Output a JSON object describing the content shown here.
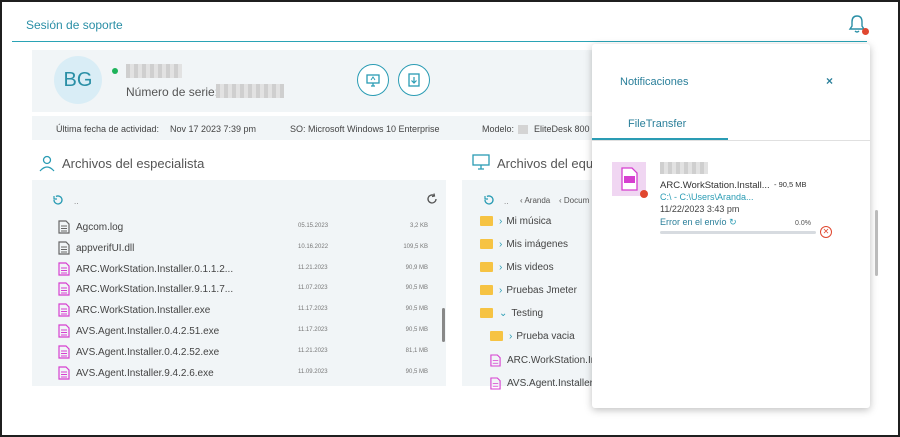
{
  "header": {
    "title": "Sesión de soporte"
  },
  "user": {
    "initials": "BG",
    "serial_label": "Número de serie:"
  },
  "activity": {
    "last_label": "Última fecha de actividad:",
    "last_value": "Nov 17 2023 7:39 pm",
    "os_label": "SO:",
    "os_value": "Microsoft Windows 10 Enterprise",
    "model_label": "Modelo:",
    "model_value": "EliteDesk 800"
  },
  "specialist_panel": {
    "title": "Archivos del especialista",
    "path": "..",
    "files": [
      {
        "name": "Agcom.log",
        "date": "05.15.2023",
        "size": "3,2 KB",
        "type": "doc"
      },
      {
        "name": "appverifUI.dll",
        "date": "10.16.2022",
        "size": "109,5 KB",
        "type": "doc"
      },
      {
        "name": "ARC.WorkStation.Installer.0.1.1.2...",
        "date": "11.21.2023",
        "size": "90,9 MB",
        "type": "exe"
      },
      {
        "name": "ARC.WorkStation.Installer.9.1.1.7...",
        "date": "11.07.2023",
        "size": "90,5 MB",
        "type": "exe"
      },
      {
        "name": "ARC.WorkStation.Installer.exe",
        "date": "11.17.2023",
        "size": "90,5 MB",
        "type": "exe"
      },
      {
        "name": "AVS.Agent.Installer.0.4.2.51.exe",
        "date": "11.17.2023",
        "size": "90,5 MB",
        "type": "exe"
      },
      {
        "name": "AVS.Agent.Installer.0.4.2.52.exe",
        "date": "11.21.2023",
        "size": "81,1 MB",
        "type": "exe"
      },
      {
        "name": "AVS.Agent.Installer.9.4.2.6.exe",
        "date": "11.09.2023",
        "size": "90,5 MB",
        "type": "exe"
      }
    ]
  },
  "device_panel": {
    "title": "Archivos del equipo",
    "breadcrumb_1": "Aranda",
    "breadcrumb_2": "Docum",
    "tree": [
      {
        "label": "Mi música",
        "indent": 0,
        "kind": "folder"
      },
      {
        "label": "Mis imágenes",
        "indent": 0,
        "kind": "folder"
      },
      {
        "label": "Mis videos",
        "indent": 0,
        "kind": "folder"
      },
      {
        "label": "Pruebas Jmeter",
        "indent": 0,
        "kind": "folder"
      },
      {
        "label": "Testing",
        "indent": 0,
        "kind": "folder-open"
      },
      {
        "label": "Prueba vacia",
        "indent": 1,
        "kind": "folder"
      },
      {
        "label": "ARC.WorkStation.In",
        "indent": 1,
        "kind": "file"
      },
      {
        "label": "AVS.Agent.Installer",
        "indent": 1,
        "kind": "file"
      }
    ]
  },
  "notifications": {
    "title": "Notificaciones",
    "close": "×",
    "tab": "FileTransfer",
    "item": {
      "filename": "ARC.WorkStation.Install...",
      "size": "- 90,5 MB",
      "path": "C:\\ - C:\\Users\\Aranda...",
      "datetime": "11/22/2023 3:43 pm",
      "status": "Error en el envío",
      "percent_label": "0.0%",
      "progress": 0.0
    }
  },
  "colors": {
    "accent": "#2a9cb4",
    "error": "#e0472f",
    "folder": "#f6c343",
    "exe_file": "#d63fd0"
  }
}
